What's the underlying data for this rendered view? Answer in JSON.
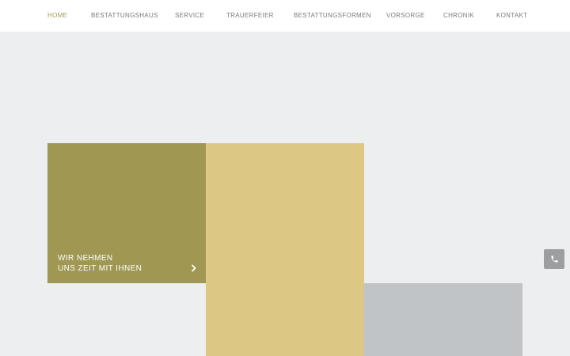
{
  "nav": {
    "items": [
      {
        "label": "HOME",
        "active": true
      },
      {
        "label": "BESTATTUNGSHAUS"
      },
      {
        "label": "SERVICE"
      },
      {
        "label": "TRAUERFEIER"
      },
      {
        "label": "BESTATTUNGSFORMEN"
      },
      {
        "label": "VORSORGE"
      },
      {
        "label": "CHRONIK"
      },
      {
        "label": "KONTAKT"
      }
    ]
  },
  "hero": {
    "tile": {
      "line1": "WIR NEHMEN",
      "line2": "UNS ZEIT MIT IHNEN",
      "icon": "chevron-right-icon"
    }
  },
  "phone_button": {
    "icon": "phone-icon"
  },
  "colors": {
    "accent": "#a09a56",
    "olive": "#a09753",
    "gold": "#ddc785",
    "grey": "#c1c4c6",
    "background": "#edeef0"
  }
}
